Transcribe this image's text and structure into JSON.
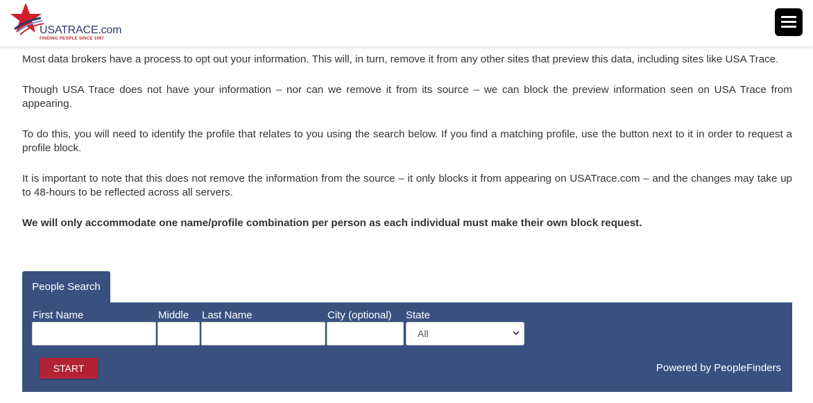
{
  "header": {
    "logo_text": "USATRACE.com",
    "logo_tagline": "FINDING PEOPLE SINCE 1997",
    "menu_icon": "hamburger-menu-icon"
  },
  "content": {
    "paragraphs": [
      "Most data brokers have a process to opt out your information. This will, in turn, remove it from any other sites that preview this data, including sites like USA Trace.",
      "Though USA Trace does not have your information – nor can we remove it from its source – we can block the preview information seen on USA Trace from appearing.",
      "To do this, you will need to identify the profile that relates to you using the search below. If you find a matching profile, use the button next to it in order to request a profile block.",
      "It is important to note that this does not remove the information from the source – it only blocks it from appearing on USATrace.com – and the changes may take up to 48-hours to be reflected across all servers.",
      "We will only accommodate one name/profile combination per person as each individual must make their own block request."
    ]
  },
  "search": {
    "tab_label": "People Search",
    "first_name_label": "First Name",
    "first_name_value": "",
    "middle_label": "Middle",
    "middle_value": "",
    "last_name_label": "Last Name",
    "last_name_value": "",
    "city_label": "City (optional)",
    "city_value": "",
    "state_label": "State",
    "state_value": "All",
    "start_label": "START",
    "powered_by": "Powered by PeopleFinders"
  },
  "colors": {
    "panel": "#3a5180",
    "start_button": "#b22234",
    "logo_red": "#c0272d",
    "logo_blue": "#2b3a6e"
  }
}
